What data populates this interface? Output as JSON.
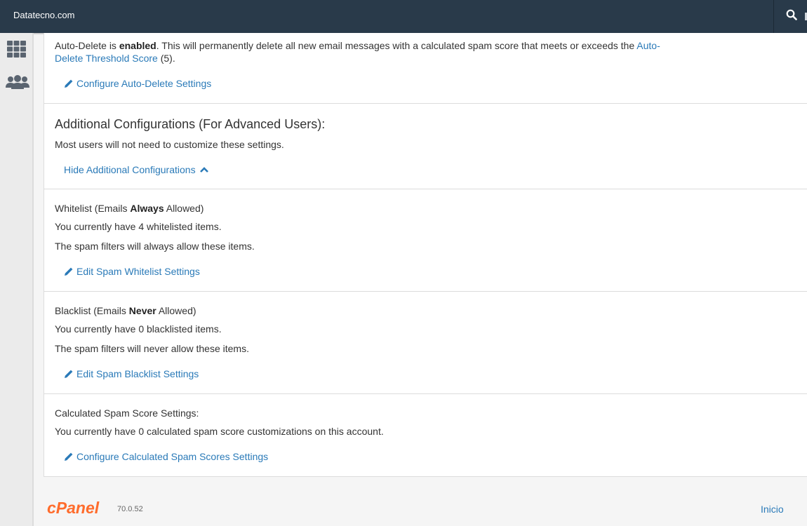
{
  "topbar": {
    "brand": "Datatecno.com",
    "search_icon": "search-icon"
  },
  "sidebar": {
    "items": [
      {
        "icon": "grid-apps-icon"
      },
      {
        "icon": "users-group-icon"
      }
    ]
  },
  "autodelete": {
    "prefix": "Auto-Delete is ",
    "status": "enabled",
    "body": ". This will permanently delete all new email messages with a calculated spam score that meets or exceeds the ",
    "threshold_link_1": "Auto-",
    "threshold_link_2": "Delete Threshold Score",
    "threshold_value": " (5).",
    "action": "Configure Auto-Delete Settings"
  },
  "additional": {
    "heading": "Additional Configurations (For Advanced Users):",
    "description": "Most users will not need to customize these settings.",
    "toggle": "Hide Additional Configurations"
  },
  "whitelist": {
    "title_prefix": "Whitelist (Emails ",
    "title_bold": "Always",
    "title_suffix": " Allowed)",
    "count_text": "You currently have 4 whitelisted items.",
    "description": "The spam filters will always allow these items.",
    "action": "Edit Spam Whitelist Settings"
  },
  "blacklist": {
    "title_prefix": "Blacklist (Emails ",
    "title_bold": "Never",
    "title_suffix": " Allowed)",
    "count_text": "You currently have 0 blacklisted items.",
    "description": "The spam filters will never allow these items.",
    "action": "Edit Spam Blacklist Settings"
  },
  "spamscore": {
    "title": "Calculated Spam Score Settings:",
    "count_text": "You currently have 0 calculated spam score customizations on this account.",
    "action": "Configure Calculated Spam Scores Settings"
  },
  "footer": {
    "logo_text": "cPanel",
    "version": "70.0.52",
    "home_link": "Inicio"
  },
  "colors": {
    "topbar": "#293a4a",
    "link": "#2a7ab8",
    "logo": "#ff6c2c"
  }
}
